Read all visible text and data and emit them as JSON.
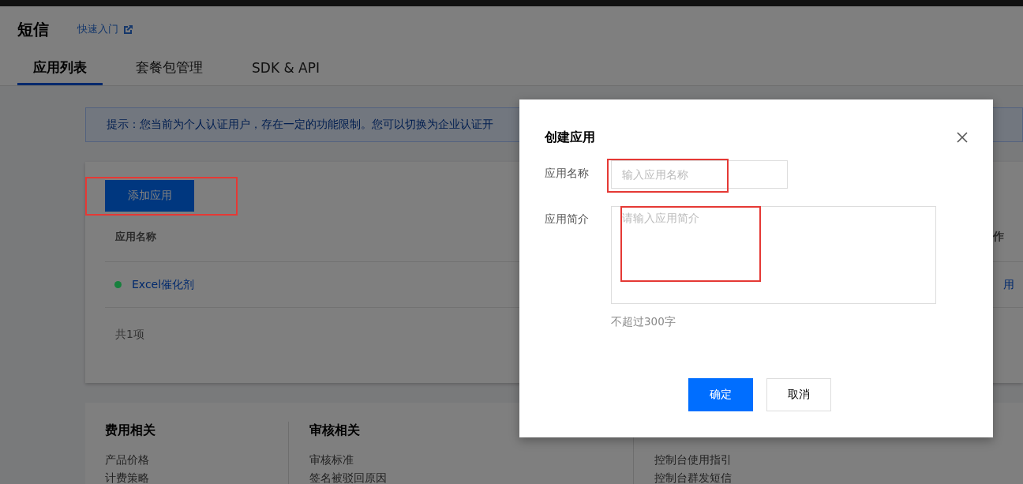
{
  "header": {
    "title": "短信",
    "quick_link": "快速入门"
  },
  "tabs": [
    {
      "label": "应用列表",
      "selected": true
    },
    {
      "label": "套餐包管理",
      "selected": false
    },
    {
      "label": "SDK & API",
      "selected": false
    }
  ],
  "notice": "提示：您当前为个人认证用户，存在一定的功能限制。您可以切换为企业认证开",
  "app_list": {
    "add_button": "添加应用",
    "columns": [
      "应用名称",
      "作"
    ],
    "rows": [
      {
        "name": "Excel催化剂",
        "color": "#17803d",
        "action": "用"
      }
    ],
    "total": "共1项"
  },
  "footer_columns": [
    {
      "title": "费用相关",
      "links": [
        "产品价格",
        "计费策略"
      ]
    },
    {
      "title": "审核相关",
      "links": [
        "审核标准",
        "签名被驳回原因"
      ]
    },
    {
      "links": [
        "控制台使用指引",
        "控制台群发短信"
      ]
    }
  ],
  "dialog": {
    "title": "创建应用",
    "fields": [
      {
        "kind": "input",
        "label": "应用名称",
        "placeholder": "输入应用名称"
      },
      {
        "kind": "textarea",
        "label": "应用简介",
        "placeholder": "请输入应用简介",
        "hint": "不超过300字"
      }
    ],
    "buttons": [
      {
        "label": "确定",
        "primary": true
      },
      {
        "label": "取消",
        "primary": false
      }
    ]
  }
}
